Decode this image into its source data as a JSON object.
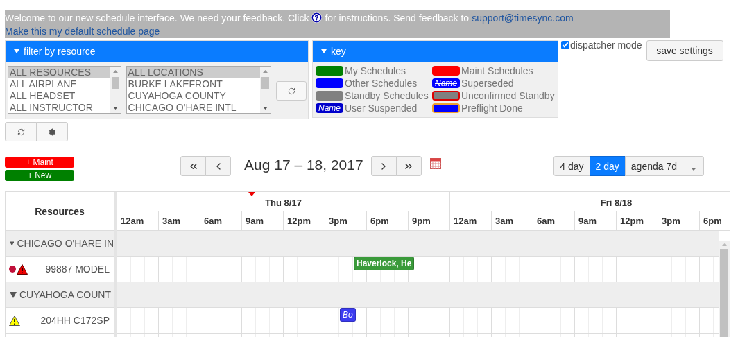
{
  "banner": {
    "message_before": "Welcome to our new schedule interface. We need your feedback. Click",
    "message_after": "for instructions. Send feedback to",
    "email": "support@timesync.com",
    "default_link": "Make this my default schedule page"
  },
  "filter": {
    "title": "filter by resource",
    "expanded": true,
    "resources": [
      {
        "label": "ALL RESOURCES",
        "selected": true
      },
      {
        "label": "ALL AIRPLANE",
        "selected": false
      },
      {
        "label": "ALL HEADSET",
        "selected": false
      },
      {
        "label": "ALL INSTRUCTOR",
        "selected": false
      }
    ],
    "locations": [
      {
        "label": "ALL LOCATIONS",
        "selected": true
      },
      {
        "label": "BURKE LAKEFRONT",
        "selected": false
      },
      {
        "label": "CUYAHOGA COUNTY",
        "selected": false
      },
      {
        "label": "CHICAGO O'HARE INTL",
        "selected": false
      }
    ]
  },
  "key": {
    "title": "key",
    "expanded": true,
    "items": [
      {
        "label": "My Schedules",
        "kind": "solid",
        "color": "#008000"
      },
      {
        "label": "Other Schedules",
        "kind": "solid",
        "color": "#0000ff"
      },
      {
        "label": "Standby Schedules",
        "kind": "solid",
        "color": "#808080"
      },
      {
        "label": "User Suspended",
        "kind": "name",
        "color": "#0000cc",
        "swatch_text": "Name"
      },
      {
        "label": "Maint Schedules",
        "kind": "solid",
        "color": "#ff0000"
      },
      {
        "label": "Superseded",
        "kind": "struck-name",
        "color": "#0000ff",
        "swatch_text": "Name"
      },
      {
        "label": "Unconfirmed Standby",
        "kind": "red-outline",
        "color": "#808080"
      },
      {
        "label": "Preflight Done",
        "kind": "orange-outline",
        "color": "#0000ff"
      }
    ]
  },
  "dispatcher_mode": {
    "label": "dispatcher mode",
    "checked": true
  },
  "save_button": "save settings",
  "actions": [
    {
      "label": "+ Maint",
      "color": "#ff0000"
    },
    {
      "label": "+ New",
      "color": "#008000"
    }
  ],
  "date_range": "Aug 17 – 18, 2017",
  "views": [
    {
      "label": "4 day",
      "selected": false
    },
    {
      "label": "2 day",
      "selected": true
    },
    {
      "label": "agenda 7d",
      "selected": false
    }
  ],
  "scheduler": {
    "resources_header": "Resources",
    "days": [
      {
        "label": "Thu 8/17",
        "hours": [
          "12am",
          "3am",
          "6am",
          "9am",
          "12pm",
          "3pm",
          "6pm",
          "9pm"
        ]
      },
      {
        "label": "Fri 8/18",
        "hours": [
          "12am",
          "3am",
          "6am",
          "9am",
          "12pm",
          "3pm",
          "6pm"
        ]
      }
    ],
    "groups": [
      {
        "name": "CHICAGO O'HARE IN",
        "expanded": true,
        "resources": [
          {
            "name": "99887 MODEL",
            "status_icons": [
              {
                "kind": "red-dot"
              },
              {
                "kind": "red-warning"
              }
            ],
            "events": [
              {
                "label": "Haverlock, He",
                "kind": "plain",
                "color": "#3a9a3a"
              }
            ]
          }
        ]
      },
      {
        "name": "CUYAHOGA COUNT",
        "expanded": true,
        "resources": [
          {
            "name": "204HH C172SP",
            "status_icons": [
              {
                "kind": "yellow-warning"
              }
            ],
            "events": [
              {
                "label": "Bo",
                "kind": "suspended",
                "color": "#3c3cf0"
              }
            ]
          }
        ]
      }
    ]
  }
}
